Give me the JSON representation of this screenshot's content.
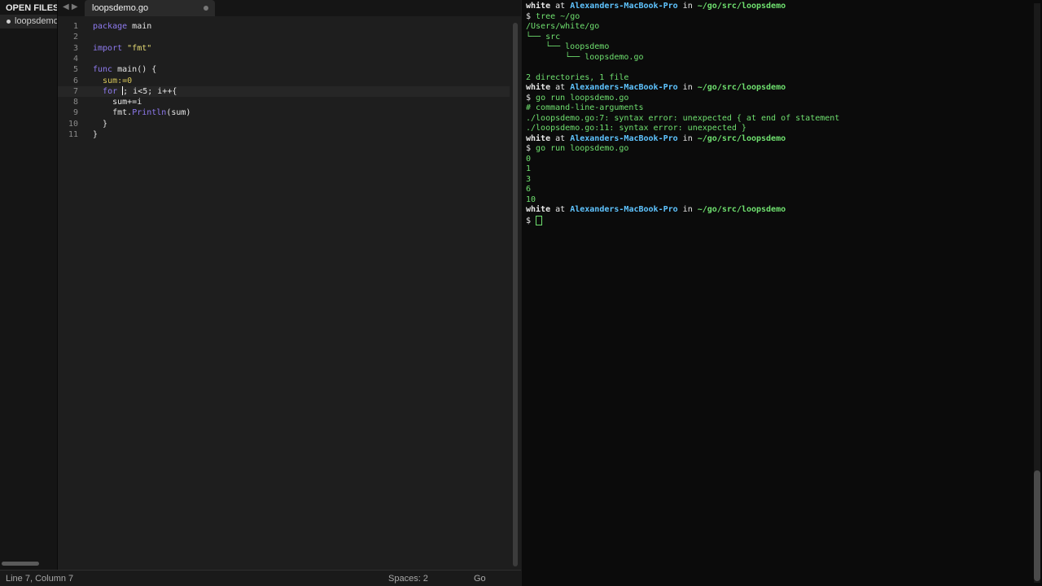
{
  "sidebar": {
    "header": "OPEN FILES",
    "file": "loopsdemo.go"
  },
  "tab": {
    "title": "loopsdemo.go"
  },
  "code_lines": [
    {
      "num": "1"
    },
    {
      "num": "2"
    },
    {
      "num": "3"
    },
    {
      "num": "4"
    },
    {
      "num": "5"
    },
    {
      "num": "6"
    },
    {
      "num": "7"
    },
    {
      "num": "8"
    },
    {
      "num": "9"
    },
    {
      "num": "10"
    },
    {
      "num": "11"
    }
  ],
  "code": {
    "l1_kw": "package",
    "l1_rest": " main",
    "l3_kw": "import",
    "l3_str": "\"fmt\"",
    "l5_kw": "func",
    "l5_rest": " main() {",
    "l6": "sum:=0",
    "l7_kw": "for",
    "l7_rest": "; i<5; i++{",
    "l8": "sum+=i",
    "l9_pkg": "fmt.",
    "l9_fn": "Println",
    "l9_rest": "(sum)",
    "l10": "}",
    "l11": "}"
  },
  "status": {
    "position": "Line 7, Column 7",
    "spaces": "Spaces: 2",
    "syntax": "Go"
  },
  "terminal": {
    "user": "white",
    "at": " at ",
    "host": "Alexanders-MacBook-Pro",
    "in": " in ",
    "dir": "~/go/src/loopsdemo",
    "prompt": "$ ",
    "cmd1": "tree ~/go",
    "tree1": "/Users/white/go",
    "tree2": "└── src",
    "tree3": "    └── loopsdemo",
    "tree4": "        └── loopsdemo.go",
    "summary": "2 directories, 1 file",
    "cmd2": "go run loopsdemo.go",
    "err1": "# command-line-arguments",
    "err2": "./loopsdemo.go:7: syntax error: unexpected { at end of statement",
    "err3": "./loopsdemo.go:11: syntax error: unexpected }",
    "cmd3": "go run loopsdemo.go",
    "out": [
      "0",
      "1",
      "3",
      "6",
      "10"
    ]
  },
  "colors": {
    "keyword": "#8f7bf0",
    "string": "#e6db74",
    "terminal_green": "#6fe06f",
    "terminal_host": "#5fc4ff"
  }
}
